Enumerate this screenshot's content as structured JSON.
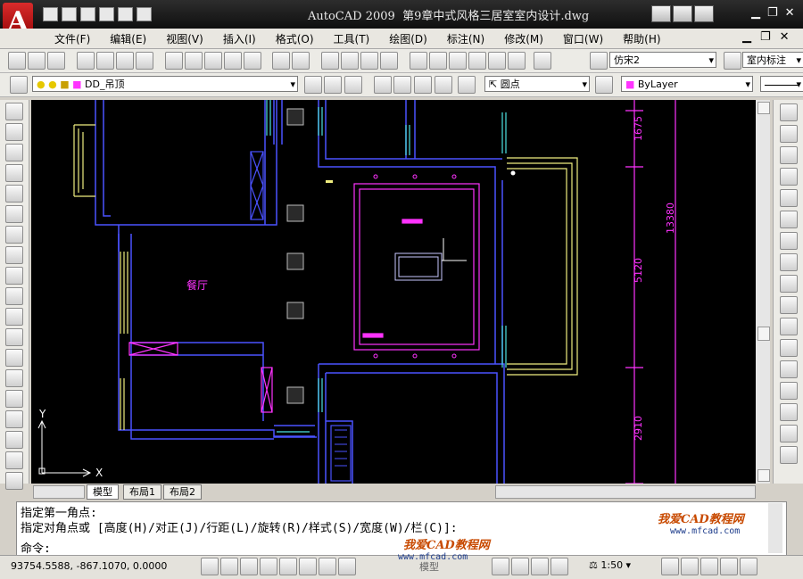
{
  "window": {
    "app_logo": "A",
    "title": "AutoCAD 2009",
    "file_title": "第9章中式风格三居室室内设计.dwg"
  },
  "menu": [
    "文件(F)",
    "编辑(E)",
    "视图(V)",
    "插入(I)",
    "格式(O)",
    "工具(T)",
    "绘图(D)",
    "标注(N)",
    "修改(M)",
    "窗口(W)",
    "帮助(H)"
  ],
  "toolbar": {
    "text_style": "仿宋2",
    "dim_style": "室内标注",
    "layer": "DD_吊顶",
    "point_style": "圆点",
    "linetype": "ByLayer"
  },
  "drawing": {
    "room_label": "餐厅",
    "dims": [
      "1675",
      "13380",
      "5120",
      "2910"
    ],
    "ucs_x": "X",
    "ucs_y": "Y"
  },
  "tabs": [
    "模型",
    "布局1",
    "布局2"
  ],
  "command": {
    "line1": "指定第一角点:",
    "line2": "指定对角点或 [高度(H)/对正(J)/行距(L)/旋转(R)/样式(S)/宽度(W)/栏(C)]:",
    "prompt": "命令:"
  },
  "status": {
    "coords": "93754.5588, -867.1070, 0.0000",
    "model_label": "模型",
    "scale": "1:50"
  },
  "watermark": {
    "text": "我爱CAD教程网",
    "url": "www.mfcad.com"
  },
  "colors": {
    "wall": "#4a52ff",
    "magenta": "#ff33ff",
    "cyan": "#4ee2e2",
    "yellow": "#f0ee80",
    "white": "#ffffff"
  }
}
